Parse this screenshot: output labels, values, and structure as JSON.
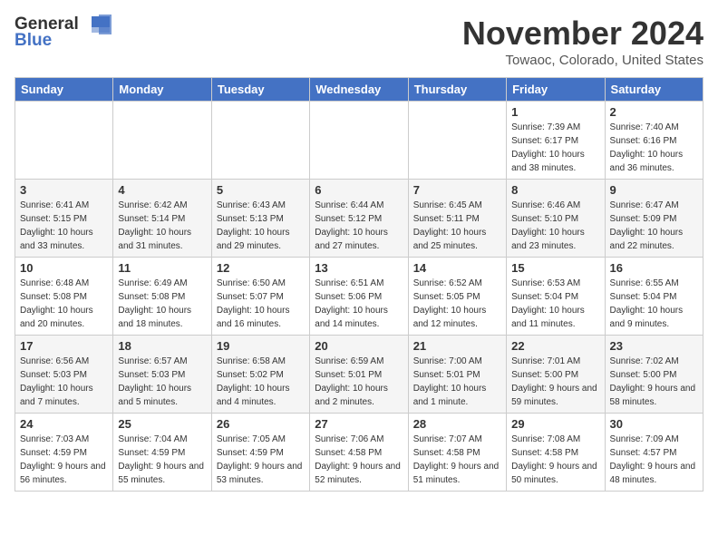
{
  "logo": {
    "general": "General",
    "blue": "Blue"
  },
  "title": "November 2024",
  "location": "Towaoc, Colorado, United States",
  "header_days": [
    "Sunday",
    "Monday",
    "Tuesday",
    "Wednesday",
    "Thursday",
    "Friday",
    "Saturday"
  ],
  "weeks": [
    [
      {
        "day": "",
        "info": ""
      },
      {
        "day": "",
        "info": ""
      },
      {
        "day": "",
        "info": ""
      },
      {
        "day": "",
        "info": ""
      },
      {
        "day": "",
        "info": ""
      },
      {
        "day": "1",
        "info": "Sunrise: 7:39 AM\nSunset: 6:17 PM\nDaylight: 10 hours and 38 minutes."
      },
      {
        "day": "2",
        "info": "Sunrise: 7:40 AM\nSunset: 6:16 PM\nDaylight: 10 hours and 36 minutes."
      }
    ],
    [
      {
        "day": "3",
        "info": "Sunrise: 6:41 AM\nSunset: 5:15 PM\nDaylight: 10 hours and 33 minutes."
      },
      {
        "day": "4",
        "info": "Sunrise: 6:42 AM\nSunset: 5:14 PM\nDaylight: 10 hours and 31 minutes."
      },
      {
        "day": "5",
        "info": "Sunrise: 6:43 AM\nSunset: 5:13 PM\nDaylight: 10 hours and 29 minutes."
      },
      {
        "day": "6",
        "info": "Sunrise: 6:44 AM\nSunset: 5:12 PM\nDaylight: 10 hours and 27 minutes."
      },
      {
        "day": "7",
        "info": "Sunrise: 6:45 AM\nSunset: 5:11 PM\nDaylight: 10 hours and 25 minutes."
      },
      {
        "day": "8",
        "info": "Sunrise: 6:46 AM\nSunset: 5:10 PM\nDaylight: 10 hours and 23 minutes."
      },
      {
        "day": "9",
        "info": "Sunrise: 6:47 AM\nSunset: 5:09 PM\nDaylight: 10 hours and 22 minutes."
      }
    ],
    [
      {
        "day": "10",
        "info": "Sunrise: 6:48 AM\nSunset: 5:08 PM\nDaylight: 10 hours and 20 minutes."
      },
      {
        "day": "11",
        "info": "Sunrise: 6:49 AM\nSunset: 5:08 PM\nDaylight: 10 hours and 18 minutes."
      },
      {
        "day": "12",
        "info": "Sunrise: 6:50 AM\nSunset: 5:07 PM\nDaylight: 10 hours and 16 minutes."
      },
      {
        "day": "13",
        "info": "Sunrise: 6:51 AM\nSunset: 5:06 PM\nDaylight: 10 hours and 14 minutes."
      },
      {
        "day": "14",
        "info": "Sunrise: 6:52 AM\nSunset: 5:05 PM\nDaylight: 10 hours and 12 minutes."
      },
      {
        "day": "15",
        "info": "Sunrise: 6:53 AM\nSunset: 5:04 PM\nDaylight: 10 hours and 11 minutes."
      },
      {
        "day": "16",
        "info": "Sunrise: 6:55 AM\nSunset: 5:04 PM\nDaylight: 10 hours and 9 minutes."
      }
    ],
    [
      {
        "day": "17",
        "info": "Sunrise: 6:56 AM\nSunset: 5:03 PM\nDaylight: 10 hours and 7 minutes."
      },
      {
        "day": "18",
        "info": "Sunrise: 6:57 AM\nSunset: 5:03 PM\nDaylight: 10 hours and 5 minutes."
      },
      {
        "day": "19",
        "info": "Sunrise: 6:58 AM\nSunset: 5:02 PM\nDaylight: 10 hours and 4 minutes."
      },
      {
        "day": "20",
        "info": "Sunrise: 6:59 AM\nSunset: 5:01 PM\nDaylight: 10 hours and 2 minutes."
      },
      {
        "day": "21",
        "info": "Sunrise: 7:00 AM\nSunset: 5:01 PM\nDaylight: 10 hours and 1 minute."
      },
      {
        "day": "22",
        "info": "Sunrise: 7:01 AM\nSunset: 5:00 PM\nDaylight: 9 hours and 59 minutes."
      },
      {
        "day": "23",
        "info": "Sunrise: 7:02 AM\nSunset: 5:00 PM\nDaylight: 9 hours and 58 minutes."
      }
    ],
    [
      {
        "day": "24",
        "info": "Sunrise: 7:03 AM\nSunset: 4:59 PM\nDaylight: 9 hours and 56 minutes."
      },
      {
        "day": "25",
        "info": "Sunrise: 7:04 AM\nSunset: 4:59 PM\nDaylight: 9 hours and 55 minutes."
      },
      {
        "day": "26",
        "info": "Sunrise: 7:05 AM\nSunset: 4:59 PM\nDaylight: 9 hours and 53 minutes."
      },
      {
        "day": "27",
        "info": "Sunrise: 7:06 AM\nSunset: 4:58 PM\nDaylight: 9 hours and 52 minutes."
      },
      {
        "day": "28",
        "info": "Sunrise: 7:07 AM\nSunset: 4:58 PM\nDaylight: 9 hours and 51 minutes."
      },
      {
        "day": "29",
        "info": "Sunrise: 7:08 AM\nSunset: 4:58 PM\nDaylight: 9 hours and 50 minutes."
      },
      {
        "day": "30",
        "info": "Sunrise: 7:09 AM\nSunset: 4:57 PM\nDaylight: 9 hours and 48 minutes."
      }
    ]
  ]
}
